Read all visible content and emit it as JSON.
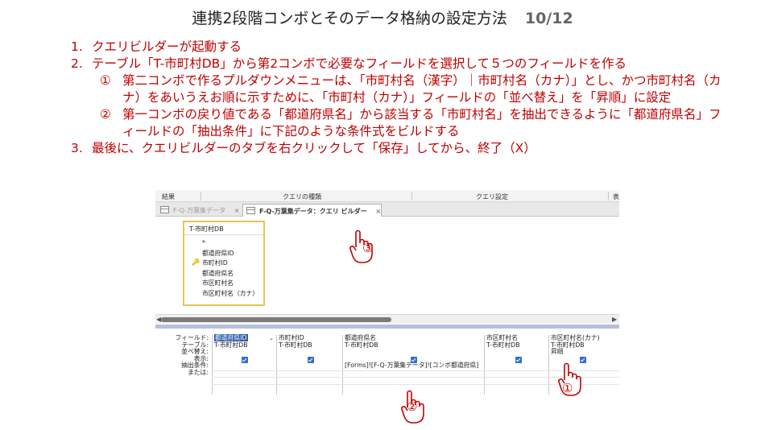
{
  "header": {
    "title": "連携2段階コンボとそのデータ格納の設定方法",
    "page": "10/12"
  },
  "steps": [
    {
      "num": "1.",
      "text": "クエリビルダーが起動する"
    },
    {
      "num": "2.",
      "text": "テーブル「T-市町村DB」から第2コンボで必要なフィールドを選択して５つのフィールドを作る"
    },
    {
      "num": "3.",
      "text": "最後に、クエリビルダーのタブを右クリックして「保存」してから、終了（X）"
    }
  ],
  "substeps": [
    {
      "mark": "①",
      "text": "第二コンボで作るプルダウンメニューは、「市町村名（漢字）｜市町村名（カナ）」とし、かつ市町村名（カナ）をあいうえお順に示すために、「市町村（カナ）」フィールドの「並べ替え」を「昇順」に設定"
    },
    {
      "mark": "②",
      "text": "第一コンボの戻り値である「都道府県名」から該当する「市町村名」を抽出できるように「都道府県名」フィールドの「抽出条件」に下記のような条件式をビルドする"
    }
  ],
  "ribbon": {
    "results": "結果",
    "query_type": "クエリの種類",
    "query_setup": "クエリ設定",
    "more": "表"
  },
  "tabs": [
    {
      "label": "F-Q-万葉集データ",
      "close": "×"
    },
    {
      "label": "F-Q-万葉集データ：クエリ ビルダー",
      "close": "×"
    }
  ],
  "table_box": {
    "name": "T-市町村DB",
    "fields": [
      "*",
      "都道府県ID",
      "市町村ID",
      "都道府県名",
      "市区町村名",
      "市区町村名（カナ）"
    ]
  },
  "grid": {
    "row_labels": [
      "フィールド:",
      "テーブル:",
      "並べ替え:",
      "表示:",
      "抽出条件:",
      "または:"
    ],
    "columns": [
      {
        "field": "都道府県ID",
        "table": "T-市町村DB",
        "sort": "",
        "criteria": ""
      },
      {
        "field": "市町村ID",
        "table": "T-市町村DB",
        "sort": "",
        "criteria": ""
      },
      {
        "field": "都道府県名",
        "table": "T-市町村DB",
        "sort": "",
        "criteria": "[Forms]![F-Q-万葉集データ]![コンボ都道府県]"
      },
      {
        "field": "市区町村名",
        "table": "T-市町村DB",
        "sort": "",
        "criteria": ""
      },
      {
        "field": "市区町村名(カナ)",
        "table": "T-市町村DB",
        "sort": "昇順",
        "criteria": ""
      }
    ]
  },
  "callouts": [
    "①",
    "②",
    "③"
  ],
  "colors": {
    "accent_red": "#c00000",
    "checkbox_blue": "#2f6fca",
    "table_border": "#e8c25a"
  },
  "icons": [
    "pointing-hand-icon",
    "key-icon",
    "checkbox-icon",
    "close-icon",
    "dropdown-arrow-icon"
  ]
}
